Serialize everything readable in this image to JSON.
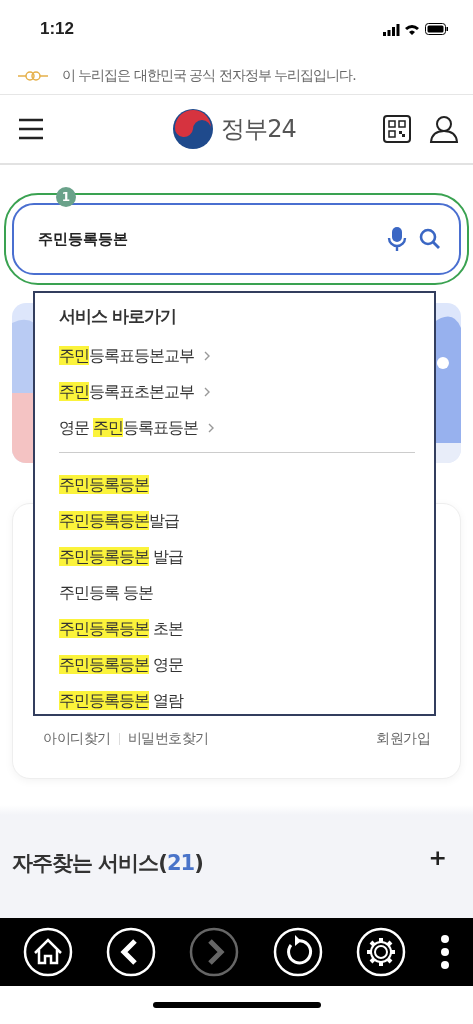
{
  "status_bar": {
    "time": "1:12"
  },
  "notice": {
    "text": "이 누리집은 대한민국 공식 전자정부 누리집입니다."
  },
  "header": {
    "logo_text": "정부24"
  },
  "search": {
    "value": "주민등록등본",
    "callout": "1"
  },
  "suggestions": {
    "heading": "서비스 바로가기",
    "shortcuts": [
      [
        {
          "text": "주민",
          "highlight": true
        },
        {
          "text": "등록표등본교부",
          "highlight": false
        }
      ],
      [
        {
          "text": "주민",
          "highlight": true
        },
        {
          "text": "등록표초본교부",
          "highlight": false
        }
      ],
      [
        {
          "text": "영문 ",
          "highlight": false
        },
        {
          "text": "주민",
          "highlight": true
        },
        {
          "text": "등록표등본",
          "highlight": false
        }
      ]
    ],
    "keywords": [
      [
        {
          "text": "주민등록등본",
          "highlight": true
        }
      ],
      [
        {
          "text": "주민등록등본",
          "highlight": true
        },
        {
          "text": "발급",
          "highlight": false
        }
      ],
      [
        {
          "text": "주민등록등본",
          "highlight": true
        },
        {
          "text": " 발급",
          "highlight": false
        }
      ],
      [
        {
          "text": "주민등록 등본",
          "highlight": false
        }
      ],
      [
        {
          "text": "주민등록등본",
          "highlight": true
        },
        {
          "text": " 초본",
          "highlight": false
        }
      ],
      [
        {
          "text": "주민등록등본",
          "highlight": true
        },
        {
          "text": " 영문",
          "highlight": false
        }
      ],
      [
        {
          "text": "주민등록등본",
          "highlight": true
        },
        {
          "text": " 열람",
          "highlight": false
        }
      ]
    ]
  },
  "login_links": [
    "아이디찾기",
    "비밀번호찾기",
    "회원가입"
  ],
  "frequent": {
    "title": "자주찾는 서비스(",
    "count": "21",
    "close": ")",
    "more": "+"
  },
  "toolbar": [
    {
      "kind": "home",
      "disabled": false
    },
    {
      "kind": "back",
      "disabled": false
    },
    {
      "kind": "forward",
      "disabled": true
    },
    {
      "kind": "reload",
      "disabled": false
    },
    {
      "kind": "settings",
      "disabled": false
    },
    {
      "kind": "more",
      "disabled": false
    }
  ]
}
